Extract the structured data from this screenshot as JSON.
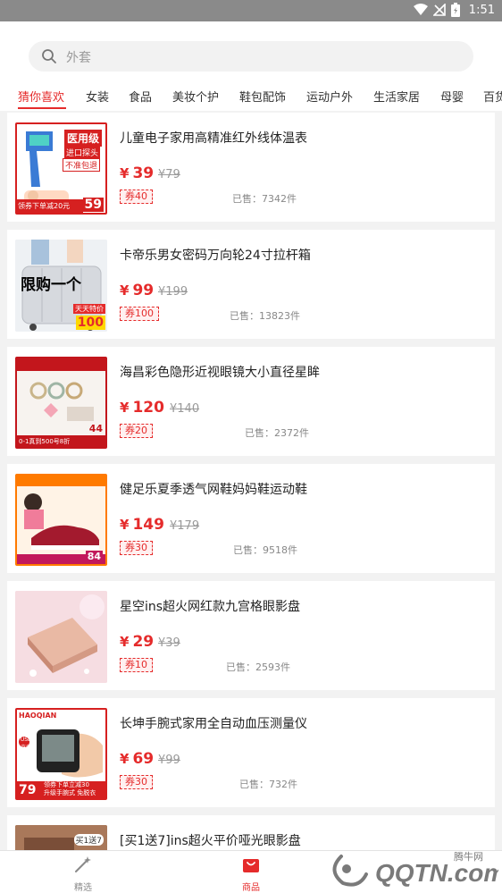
{
  "status": {
    "time": "1:51"
  },
  "search": {
    "placeholder": "外套"
  },
  "tabs": [
    {
      "label": "猜你喜欢"
    },
    {
      "label": "女装"
    },
    {
      "label": "食品"
    },
    {
      "label": "美妆个护"
    },
    {
      "label": "鞋包配饰"
    },
    {
      "label": "运动户外"
    },
    {
      "label": "生活家居"
    },
    {
      "label": "母婴"
    },
    {
      "label": "百货"
    }
  ],
  "products": [
    {
      "title": "儿童电子家用高精准红外线体温表",
      "price": "39",
      "old_price": "¥79",
      "coupon": "券40",
      "sold": "已售：7342件",
      "thumb_text": [
        "医用级",
        "进口探头",
        "不准包退",
        "领券下单减20元",
        "59"
      ]
    },
    {
      "title": "卡帝乐男女密码万向轮24寸拉杆箱",
      "price": "99",
      "old_price": "¥199",
      "coupon": "券100",
      "sold": "已售：13823件",
      "thumb_text": [
        "限购一个",
        "天天特价",
        "100"
      ]
    },
    {
      "title": "海昌彩色隐形近视眼镜大小直径星眸",
      "price": "120",
      "old_price": "¥140",
      "coupon": "券20",
      "sold": "已售：2372件",
      "thumb_text": [
        "44",
        "0-1真到500号8折"
      ]
    },
    {
      "title": "健足乐夏季透气网鞋妈妈鞋运动鞋",
      "price": "149",
      "old_price": "¥179",
      "coupon": "券30",
      "sold": "已售：9518件",
      "thumb_text": [
        "84"
      ]
    },
    {
      "title": "星空ins超火网红款九宫格眼影盘",
      "price": "29",
      "old_price": "¥39",
      "coupon": "券10",
      "sold": "已售：2593件",
      "thumb_text": []
    },
    {
      "title": "长坤手腕式家用全自动血压测量仪",
      "price": "69",
      "old_price": "¥99",
      "coupon": "券30",
      "sold": "已售：732件",
      "thumb_text": [
        "HAOQIAN",
        "USB充电",
        "79",
        "领券下单立减30",
        "升级手腕式 免脱衣"
      ]
    },
    {
      "title": "[买1送7]ins超火平价哑光眼影盘",
      "price": "",
      "old_price": "",
      "coupon": "",
      "sold": "",
      "thumb_text": [
        "买1送7"
      ]
    }
  ],
  "bottom_nav": [
    {
      "label": "精选"
    },
    {
      "label": "商品"
    }
  ],
  "watermark": {
    "text": "QQTN.com",
    "sub": "腾牛网"
  },
  "colors": {
    "accent": "#e52b2b",
    "status_bar": "#8a8a8a"
  }
}
